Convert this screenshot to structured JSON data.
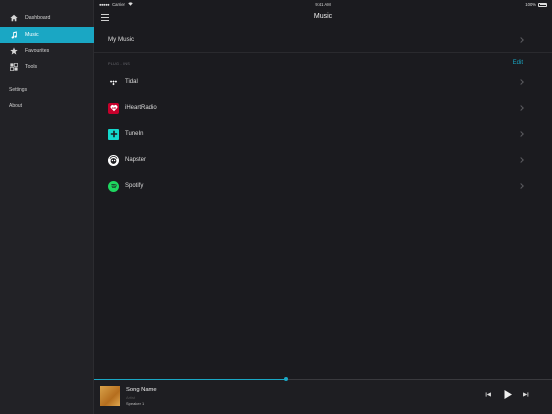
{
  "status": {
    "carrier": "Carrier",
    "time": "9:41 AM",
    "battery": "100%"
  },
  "sidebar": {
    "items": [
      {
        "label": "Dashboard",
        "icon": "home-icon",
        "active": false
      },
      {
        "label": "Music",
        "icon": "music-note-icon",
        "active": true
      },
      {
        "label": "Favourites",
        "icon": "star-icon",
        "active": false
      },
      {
        "label": "Tools",
        "icon": "tools-icon",
        "active": false
      }
    ],
    "settings": "Settings",
    "about": "About"
  },
  "header": {
    "title": "Music"
  },
  "main": {
    "my_music": "My Music",
    "section_header": "PLUG - INS",
    "edit": "Edit",
    "services": [
      {
        "label": "Tidal",
        "icon": "tidal-icon",
        "color": "#1b1b1f"
      },
      {
        "label": "iHeartRadio",
        "icon": "iheartradio-icon",
        "color": "#c6002b"
      },
      {
        "label": "TuneIn",
        "icon": "tunein-icon",
        "color": "#14d8cc"
      },
      {
        "label": "Napster",
        "icon": "napster-icon",
        "color": "#ffffff"
      },
      {
        "label": "Spotify",
        "icon": "spotify-icon",
        "color": "#1ed760"
      }
    ]
  },
  "player": {
    "song": "Song Name",
    "artist": "Artist",
    "speaker": "Speaker 1",
    "progress": 0.42
  },
  "colors": {
    "accent": "#1aa7c4",
    "background": "#1b1b1f",
    "sidebar": "#222226"
  }
}
